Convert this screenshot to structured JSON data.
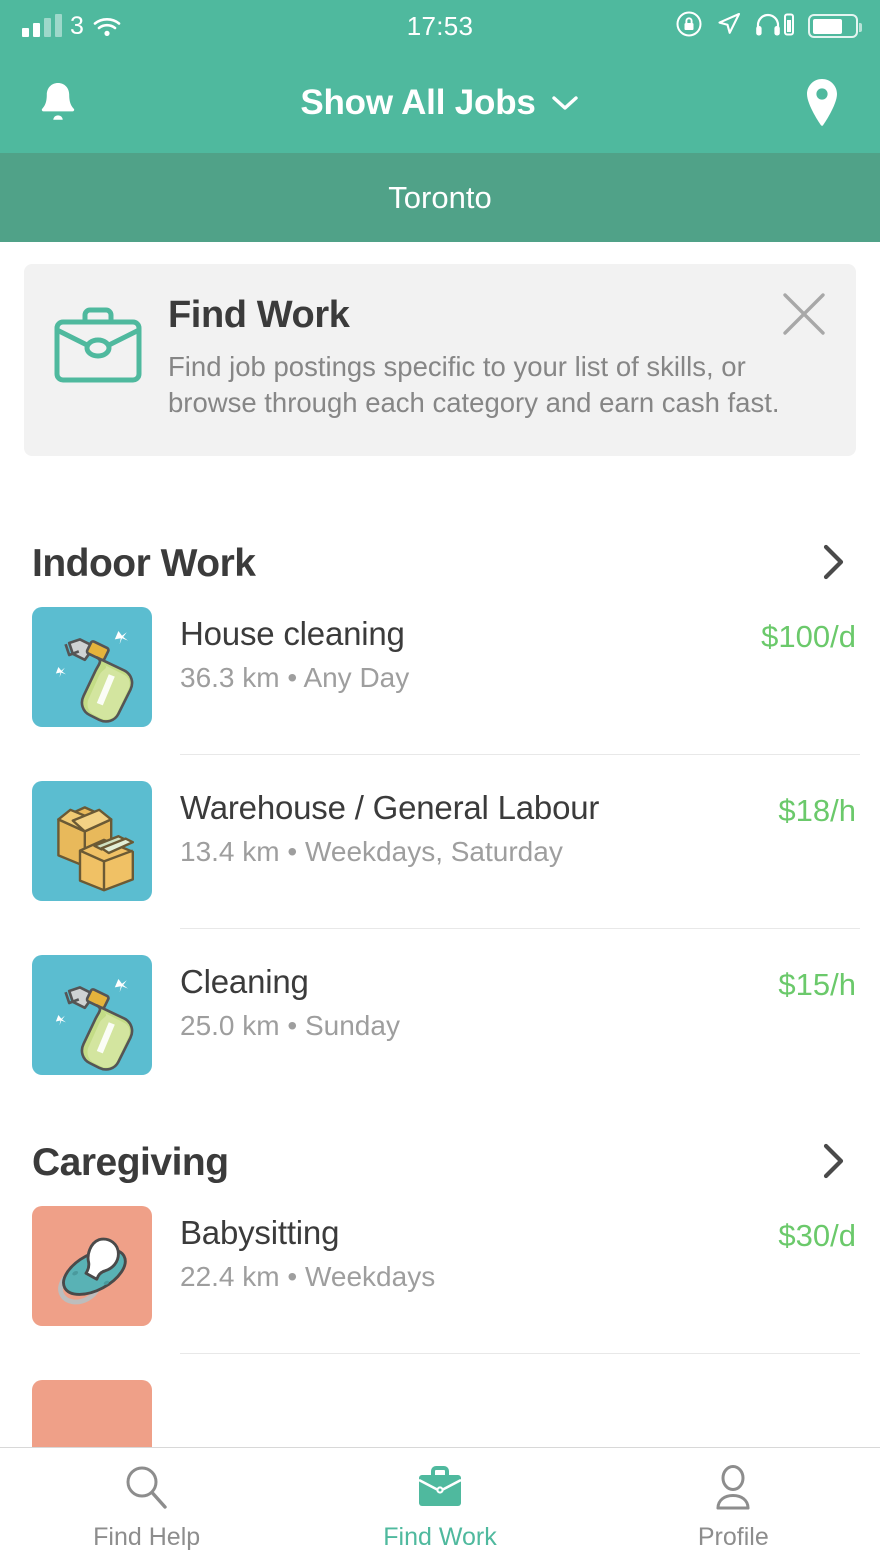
{
  "status_bar": {
    "carrier": "3",
    "time": "17:53",
    "signal_icon": "cellular-signal-icon",
    "wifi_icon": "wifi-icon",
    "rotation_lock_icon": "rotation-lock-icon",
    "location_arrow_icon": "location-arrow-icon",
    "headphones_icon": "headphones-icon",
    "battery_icon": "battery-icon"
  },
  "nav": {
    "title": "Show All Jobs",
    "chevron_icon": "chevron-down-icon",
    "bell_icon": "bell-icon",
    "pin_icon": "map-pin-icon"
  },
  "location_bar": {
    "city": "Toronto"
  },
  "promo": {
    "title": "Find Work",
    "body": "Find job postings specific to your list of skills, or browse through each category and earn cash fast.",
    "icon": "briefcase-icon",
    "close_icon": "close-icon"
  },
  "sections": [
    {
      "title": "Indoor Work",
      "chevron_icon": "chevron-right-icon",
      "jobs": [
        {
          "title": "House cleaning",
          "distance": "36.3 km",
          "separator": "•",
          "availability": "Any Day",
          "price": "$100/d",
          "icon": "spray-bottle-icon",
          "tile_color": "#5BBDD0"
        },
        {
          "title": "Warehouse / General Labour",
          "distance": "13.4 km",
          "separator": "•",
          "availability": "Weekdays, Saturday",
          "price": "$18/h",
          "icon": "cardboard-boxes-icon",
          "tile_color": "#5BBDD0"
        },
        {
          "title": "Cleaning",
          "distance": "25.0 km",
          "separator": "•",
          "availability": "Sunday",
          "price": "$15/h",
          "icon": "spray-bottle-icon",
          "tile_color": "#5BBDD0"
        }
      ]
    },
    {
      "title": "Caregiving",
      "chevron_icon": "chevron-right-icon",
      "jobs": [
        {
          "title": "Babysitting",
          "distance": "22.4 km",
          "separator": "•",
          "availability": "Weekdays",
          "price": "$30/d",
          "icon": "pacifier-icon",
          "tile_color": "#EFA088"
        }
      ]
    }
  ],
  "tabs": [
    {
      "label": "Find Help",
      "icon": "search-icon",
      "active": false
    },
    {
      "label": "Find Work",
      "icon": "briefcase-icon",
      "active": true
    },
    {
      "label": "Profile",
      "icon": "person-icon",
      "active": false
    }
  ],
  "colors": {
    "header_green": "#4FB99E",
    "location_bar_green": "#50A288",
    "price_green": "#6BC96B",
    "tile_teal": "#5BBDD0",
    "tile_salmon": "#EFA088",
    "text_dark": "#3b3b3b",
    "text_muted": "#9e9e9e"
  }
}
